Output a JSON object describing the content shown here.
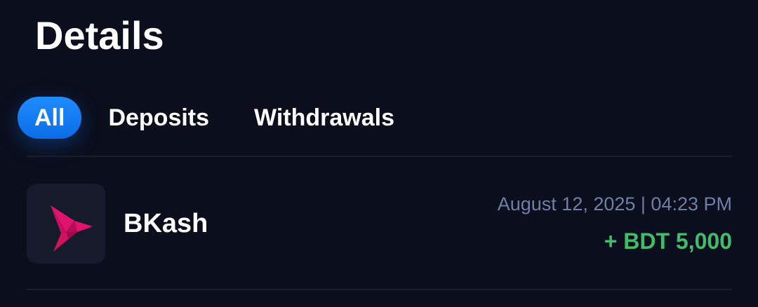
{
  "page": {
    "title": "Details"
  },
  "tabs": [
    {
      "label": "All",
      "active": true
    },
    {
      "label": "Deposits",
      "active": false
    },
    {
      "label": "Withdrawals",
      "active": false
    }
  ],
  "transactions": [
    {
      "provider": "BKash",
      "provider_icon": "bkash-bird-logo",
      "datetime": "August 12, 2025 | 04:23 PM",
      "amount": "+ BDT 5,000",
      "amount_color": "#3fbd6a"
    }
  ],
  "colors": {
    "background": "#0b0e1c",
    "accent": "#1f8cff",
    "muted_text": "#6f7fa6",
    "positive": "#3fbd6a"
  }
}
